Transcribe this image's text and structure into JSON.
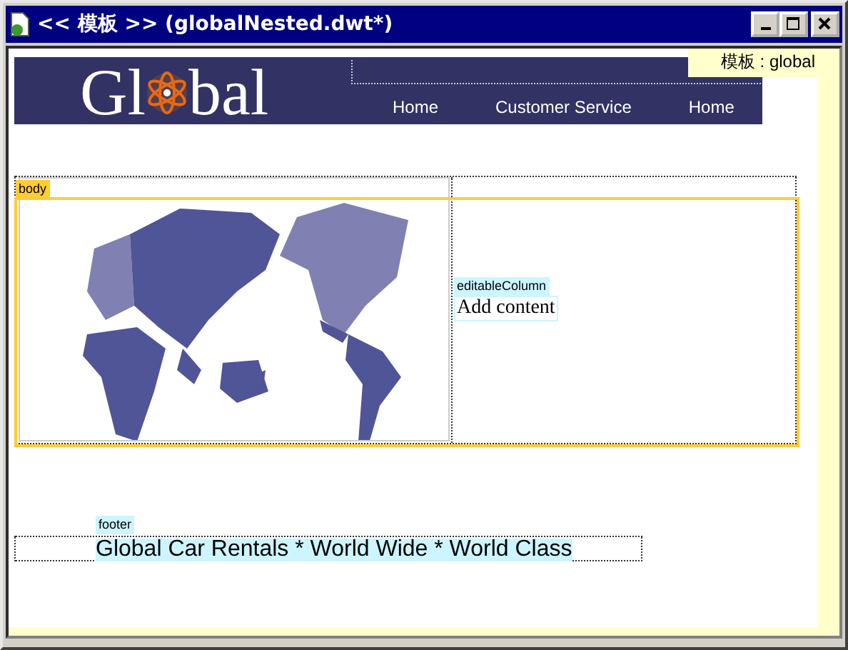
{
  "window": {
    "title": "<< 模板 >> (globalNested.dwt*)"
  },
  "template_tag": "模板 : global",
  "banner": {
    "logo": {
      "before": "Gl",
      "after": "bal"
    },
    "nav": [
      {
        "label": "Home"
      },
      {
        "label": "Customer Service"
      },
      {
        "label": "Home"
      }
    ]
  },
  "body_region": {
    "tag": "body"
  },
  "editable_column": {
    "tag": "editableColumn",
    "content": "Add content"
  },
  "footer": {
    "tag": "footer",
    "text": "Global Car Rentals * World Wide * World Class"
  }
}
